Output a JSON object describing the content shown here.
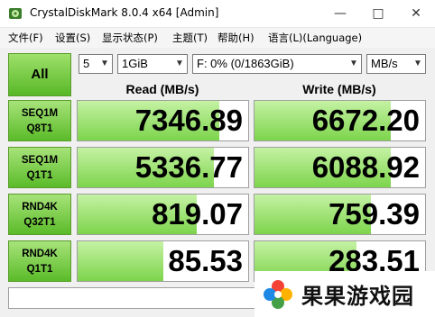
{
  "window": {
    "title": "CrystalDiskMark 8.0.4 x64 [Admin]",
    "min": "—",
    "max": "□",
    "close": "✕"
  },
  "menu": [
    "文件(F)",
    "设置(S)",
    "显示状态(P)",
    "主题(T)",
    "帮助(H)",
    "语言(L)(Language)"
  ],
  "controls": {
    "all_label": "All",
    "count": "5",
    "size": "1GiB",
    "drive": "F: 0% (0/1863GiB)",
    "unit": "MB/s"
  },
  "headers": {
    "read": "Read (MB/s)",
    "write": "Write (MB/s)"
  },
  "rows": [
    {
      "line1": "SEQ1M",
      "line2": "Q8T1",
      "read": "7346.89",
      "write": "6672.20",
      "read_level": 0.83,
      "write_level": 0.8
    },
    {
      "line1": "SEQ1M",
      "line2": "Q1T1",
      "read": "5336.77",
      "write": "6088.92",
      "read_level": 0.8,
      "write_level": 0.8
    },
    {
      "line1": "RND4K",
      "line2": "Q32T1",
      "read": "819.07",
      "write": "759.39",
      "read_level": 0.7,
      "write_level": 0.68
    },
    {
      "line1": "RND4K",
      "line2": "Q1T1",
      "read": "85.53",
      "write": "283.51",
      "read_level": 0.5,
      "write_level": 0.6
    }
  ],
  "status": "",
  "watermark": "果果游戏园",
  "colors": {
    "accent_green": "#58b826",
    "bar_green": "#7dd44c"
  }
}
